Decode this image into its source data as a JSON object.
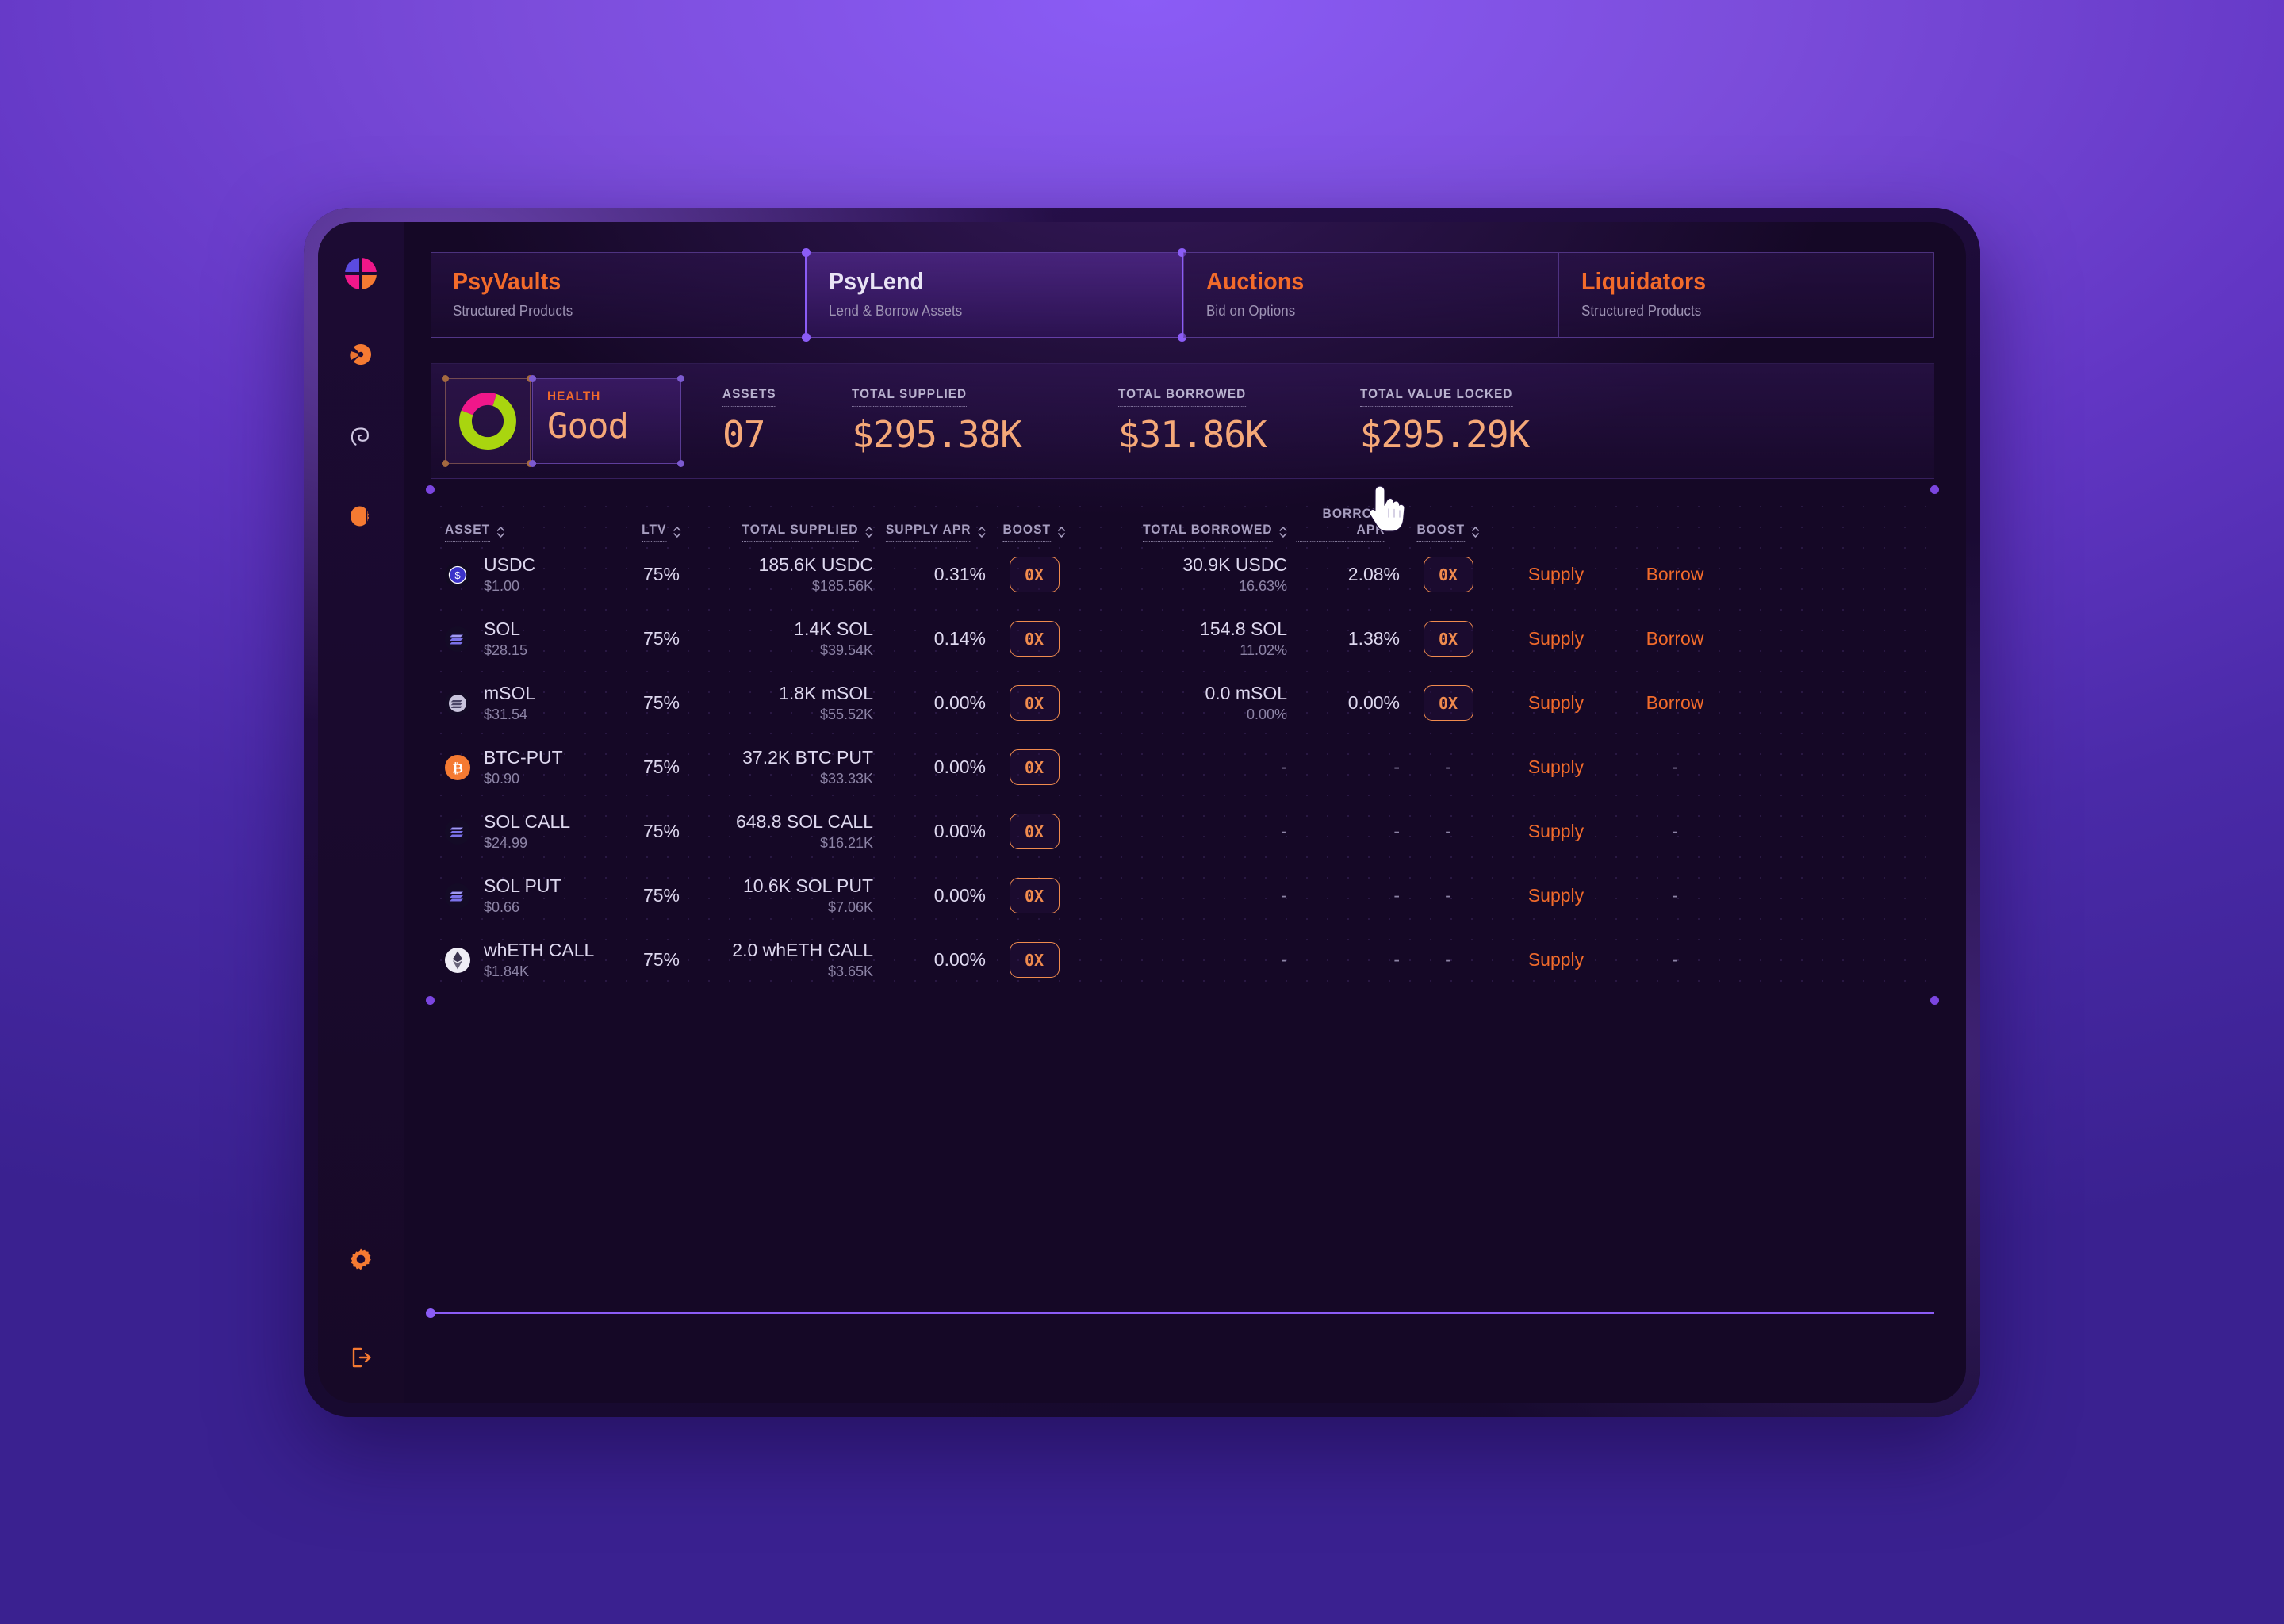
{
  "app": {
    "logo_icon": "psy-logo-icon"
  },
  "sidebar": {
    "items": [
      {
        "icon": "pie-chart-icon",
        "name": "sidebar-item-vaults"
      },
      {
        "icon": "spiral-icon",
        "name": "sidebar-item-spiral"
      },
      {
        "icon": "coin-icon",
        "name": "sidebar-item-coin"
      }
    ],
    "bottom": [
      {
        "icon": "gear-icon",
        "name": "sidebar-item-settings"
      },
      {
        "icon": "logout-icon",
        "name": "sidebar-item-logout"
      }
    ]
  },
  "tabs": [
    {
      "title": "PsyVaults",
      "subtitle": "Structured Products",
      "active": false
    },
    {
      "title": "PsyLend",
      "subtitle": "Lend & Borrow Assets",
      "active": true
    },
    {
      "title": "Auctions",
      "subtitle": "Bid on Options",
      "active": false
    },
    {
      "title": "Liquidators",
      "subtitle": "Structured Products",
      "active": false
    }
  ],
  "stats": {
    "health_label": "HEALTH",
    "health_value": "Good",
    "health_donut": {
      "good_pct": 76,
      "risk_pct": 24,
      "good_color": "#a9d50f",
      "risk_color": "#f0178a"
    },
    "items": [
      {
        "label": "ASSETS",
        "value": "07"
      },
      {
        "label": "TOTAL SUPPLIED",
        "value": "$295.38K"
      },
      {
        "label": "TOTAL BORROWED",
        "value": "$31.86K"
      },
      {
        "label": "TOTAL VALUE LOCKED",
        "value": "$295.29K"
      }
    ]
  },
  "table": {
    "headers": [
      "ASSET",
      "LTV",
      "TOTAL SUPPLIED",
      "SUPPLY APR",
      "BOOST",
      "TOTAL BORROWED",
      "BORROW APR",
      "BOOST"
    ],
    "rows": [
      {
        "icon": "usdc-icon",
        "asset": "USDC",
        "price": "$1.00",
        "ltv": "75%",
        "supplied_amount": "185.6K USDC",
        "supplied_usd": "$185.56K",
        "supply_apr": "0.31%",
        "supply_boost": "0X",
        "borrowed_amount": "30.9K USDC",
        "borrowed_pct": "16.63%",
        "borrow_apr": "2.08%",
        "borrow_boost": "0X",
        "supply_action": "Supply",
        "borrow_action": "Borrow"
      },
      {
        "icon": "sol-icon",
        "asset": "SOL",
        "price": "$28.15",
        "ltv": "75%",
        "supplied_amount": "1.4K SOL",
        "supplied_usd": "$39.54K",
        "supply_apr": "0.14%",
        "supply_boost": "0X",
        "borrowed_amount": "154.8 SOL",
        "borrowed_pct": "11.02%",
        "borrow_apr": "1.38%",
        "borrow_boost": "0X",
        "supply_action": "Supply",
        "borrow_action": "Borrow"
      },
      {
        "icon": "msol-icon",
        "asset": "mSOL",
        "price": "$31.54",
        "ltv": "75%",
        "supplied_amount": "1.8K mSOL",
        "supplied_usd": "$55.52K",
        "supply_apr": "0.00%",
        "supply_boost": "0X",
        "borrowed_amount": "0.0 mSOL",
        "borrowed_pct": "0.00%",
        "borrow_apr": "0.00%",
        "borrow_boost": "0X",
        "supply_action": "Supply",
        "borrow_action": "Borrow"
      },
      {
        "icon": "btc-icon",
        "asset": "BTC-PUT",
        "price": "$0.90",
        "ltv": "75%",
        "supplied_amount": "37.2K BTC PUT",
        "supplied_usd": "$33.33K",
        "supply_apr": "0.00%",
        "supply_boost": "0X",
        "borrowed_amount": "-",
        "borrowed_pct": "",
        "borrow_apr": "-",
        "borrow_boost": "-",
        "supply_action": "Supply",
        "borrow_action": "-"
      },
      {
        "icon": "sol-icon",
        "asset": "SOL CALL",
        "price": "$24.99",
        "ltv": "75%",
        "supplied_amount": "648.8 SOL CALL",
        "supplied_usd": "$16.21K",
        "supply_apr": "0.00%",
        "supply_boost": "0X",
        "borrowed_amount": "-",
        "borrowed_pct": "",
        "borrow_apr": "-",
        "borrow_boost": "-",
        "supply_action": "Supply",
        "borrow_action": "-"
      },
      {
        "icon": "sol-icon",
        "asset": "SOL PUT",
        "price": "$0.66",
        "ltv": "75%",
        "supplied_amount": "10.6K SOL PUT",
        "supplied_usd": "$7.06K",
        "supply_apr": "0.00%",
        "supply_boost": "0X",
        "borrowed_amount": "-",
        "borrowed_pct": "",
        "borrow_apr": "-",
        "borrow_boost": "-",
        "supply_action": "Supply",
        "borrow_action": "-"
      },
      {
        "icon": "eth-icon",
        "asset": "whETH CALL",
        "price": "$1.84K",
        "ltv": "75%",
        "supplied_amount": "2.0 whETH CALL",
        "supplied_usd": "$3.65K",
        "supply_apr": "0.00%",
        "supply_boost": "0X",
        "borrowed_amount": "-",
        "borrowed_pct": "",
        "borrow_apr": "-",
        "borrow_boost": "-",
        "supply_action": "Supply",
        "borrow_action": "-"
      }
    ]
  },
  "cursor": {
    "icon": "pointing-hand-cursor"
  },
  "colors": {
    "accent_orange": "#f26b2b",
    "value_orange": "#f5a878",
    "accent_purple": "#8b5cf6",
    "health_good": "#a9d50f",
    "health_risk": "#f0178a"
  }
}
